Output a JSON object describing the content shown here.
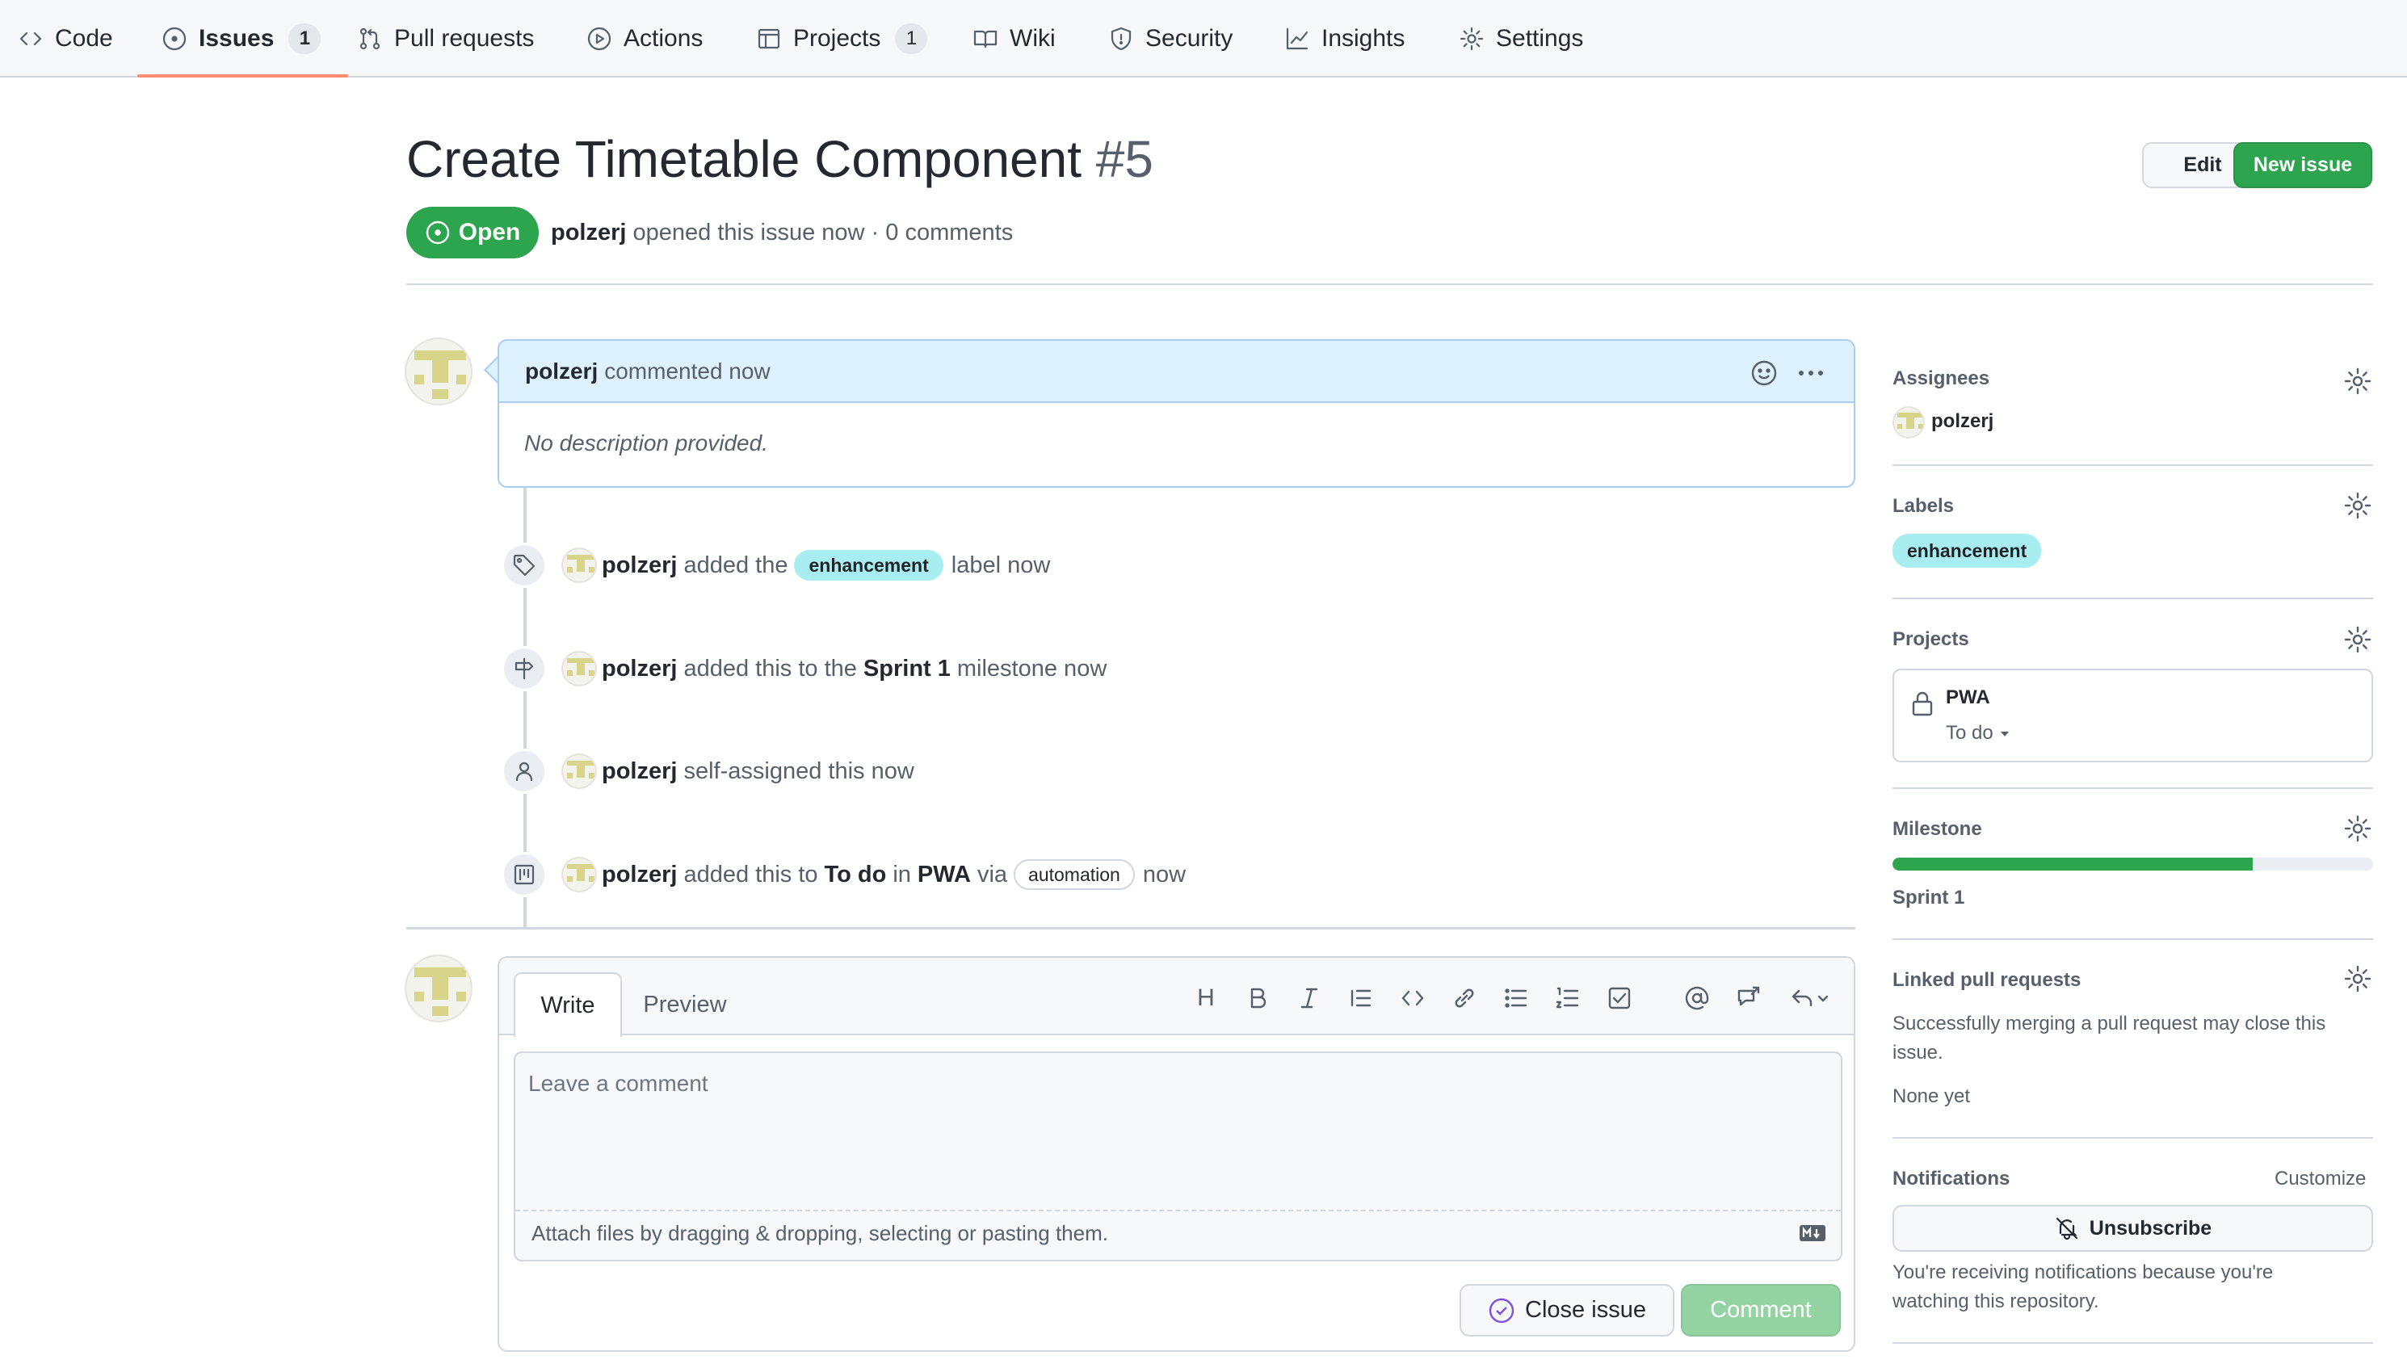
{
  "nav": {
    "tabs": [
      {
        "label": "Code",
        "icon": "code-icon"
      },
      {
        "label": "Issues",
        "icon": "issue-opened-icon",
        "count": "1",
        "selected": true
      },
      {
        "label": "Pull requests",
        "icon": "git-pull-request-icon"
      },
      {
        "label": "Actions",
        "icon": "play-icon"
      },
      {
        "label": "Projects",
        "icon": "table-icon",
        "count": "1"
      },
      {
        "label": "Wiki",
        "icon": "book-icon"
      },
      {
        "label": "Security",
        "icon": "shield-icon"
      },
      {
        "label": "Insights",
        "icon": "graph-icon"
      },
      {
        "label": "Settings",
        "icon": "gear-icon"
      }
    ]
  },
  "issue": {
    "title": "Create Timetable Component",
    "number": "#5",
    "status": "Open",
    "author": "polzerj",
    "meta_rest": "opened this issue now · 0 comments",
    "edit_label": "Edit",
    "new_issue_label": "New issue"
  },
  "comment": {
    "author": "polzerj",
    "action": "commented now",
    "body": "No description provided."
  },
  "events": {
    "label_event": {
      "user": "polzerj",
      "pre": "added the",
      "label": "enhancement",
      "post": "label now"
    },
    "milestone_event": {
      "user": "polzerj",
      "pre": "added this to the",
      "milestone": "Sprint 1",
      "post": "milestone now"
    },
    "assign_event": {
      "user": "polzerj",
      "text": "self-assigned this now"
    },
    "project_event": {
      "user": "polzerj",
      "pre": "added this to",
      "column": "To do",
      "mid": "in",
      "project": "PWA",
      "via": "via",
      "badge": "automation",
      "post": "now"
    }
  },
  "editor": {
    "tab_write": "Write",
    "tab_preview": "Preview",
    "placeholder": "Leave a comment",
    "attach_text": "Attach files by dragging & dropping, selecting or pasting them.",
    "close_label": "Close issue",
    "comment_label": "Comment",
    "heading_glyph": "H"
  },
  "sidebar": {
    "assignees": {
      "heading": "Assignees",
      "user": "polzerj"
    },
    "labels": {
      "heading": "Labels",
      "label": "enhancement",
      "label_color": "#a8eef0"
    },
    "projects": {
      "heading": "Projects",
      "name": "PWA",
      "column": "To do"
    },
    "milestone": {
      "heading": "Milestone",
      "name": "Sprint 1",
      "progress_percent": 75
    },
    "linked_prs": {
      "heading": "Linked pull requests",
      "description": "Successfully merging a pull request may close this issue.",
      "status": "None yet"
    },
    "notifications": {
      "heading": "Notifications",
      "customize": "Customize",
      "unsubscribe_label": "Unsubscribe",
      "reason": "You're receiving notifications because you're watching this repository."
    }
  },
  "colors": {
    "accent_green": "#2da44e",
    "tab_underline": "#fd8c73",
    "comment_header": "#ddf1fe"
  }
}
